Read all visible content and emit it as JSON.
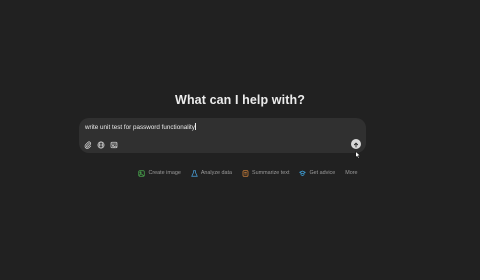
{
  "heading": "What can I help with?",
  "composer": {
    "value": "write unit test for password functionality"
  },
  "chips": [
    {
      "label": "Create image",
      "icon": "create-image-icon",
      "color": "#4caf50"
    },
    {
      "label": "Analyze data",
      "icon": "analyze-data-icon",
      "color": "#4aa3df"
    },
    {
      "label": "Summarize text",
      "icon": "summarize-text-icon",
      "color": "#e08a3c"
    },
    {
      "label": "Get advice",
      "icon": "get-advice-icon",
      "color": "#3fa5e0"
    },
    {
      "label": "More",
      "icon": "",
      "color": "#9b9b9b"
    }
  ],
  "colors": {
    "background": "#212121",
    "composer": "#303030",
    "text": "#ececec",
    "muted": "#9b9b9b"
  }
}
